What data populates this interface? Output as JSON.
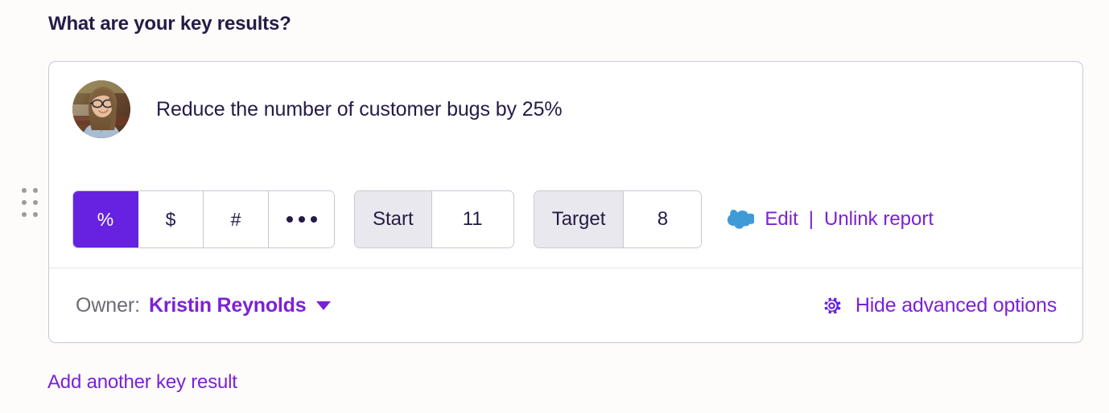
{
  "section": {
    "title": "What are your key results?"
  },
  "key_result": {
    "statement": "Reduce the number of customer bugs by 25%",
    "avatar_alt": "Kristin Reynolds avatar",
    "unit_segments": [
      {
        "label": "%",
        "name": "percent",
        "selected": true
      },
      {
        "label": "$",
        "name": "currency",
        "selected": false
      },
      {
        "label": "#",
        "name": "number",
        "selected": false
      },
      {
        "label": "•••",
        "name": "more",
        "selected": false
      }
    ],
    "start": {
      "label": "Start",
      "value": "11"
    },
    "target": {
      "label": "Target",
      "value": "8"
    },
    "report": {
      "icon": "salesforce-cloud-icon",
      "edit_label": "Edit",
      "separator": "|",
      "unlink_label": "Unlink report"
    },
    "owner": {
      "label": "Owner:",
      "name": "Kristin Reynolds",
      "caret_icon": "chevron-down-icon"
    },
    "advanced": {
      "icon": "gear-icon",
      "label": "Hide advanced options"
    }
  },
  "footer": {
    "add_label": "Add another key result"
  },
  "colors": {
    "background": "#fdfcfa",
    "card": "#ffffff",
    "card_border": "#c9c7d6",
    "accent_purple": "#7c21d4",
    "active_purple": "#6622e0",
    "text_navy": "#251b46",
    "muted_gray": "#6b6b76",
    "field_label_bg": "#e9e8ee",
    "cloud_blue": "#3f9bd6",
    "handle_gray": "#9b9b9b"
  }
}
